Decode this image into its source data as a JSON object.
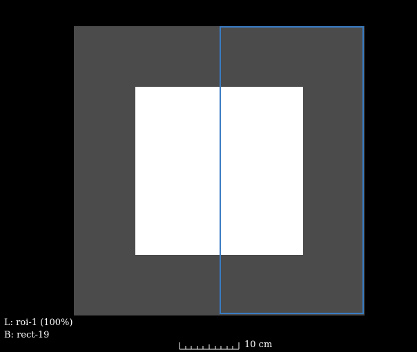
{
  "viewer": {
    "overlay": {
      "left_label": "L: roi-1 (100%)",
      "bottom_label": "B: rect-19"
    },
    "scale": {
      "label": "10 cm"
    },
    "colors": {
      "background": "#000000",
      "image_gray": "#4b4b4b",
      "image_white": "#ffffff",
      "roi_outline": "#3a7cc3"
    }
  }
}
